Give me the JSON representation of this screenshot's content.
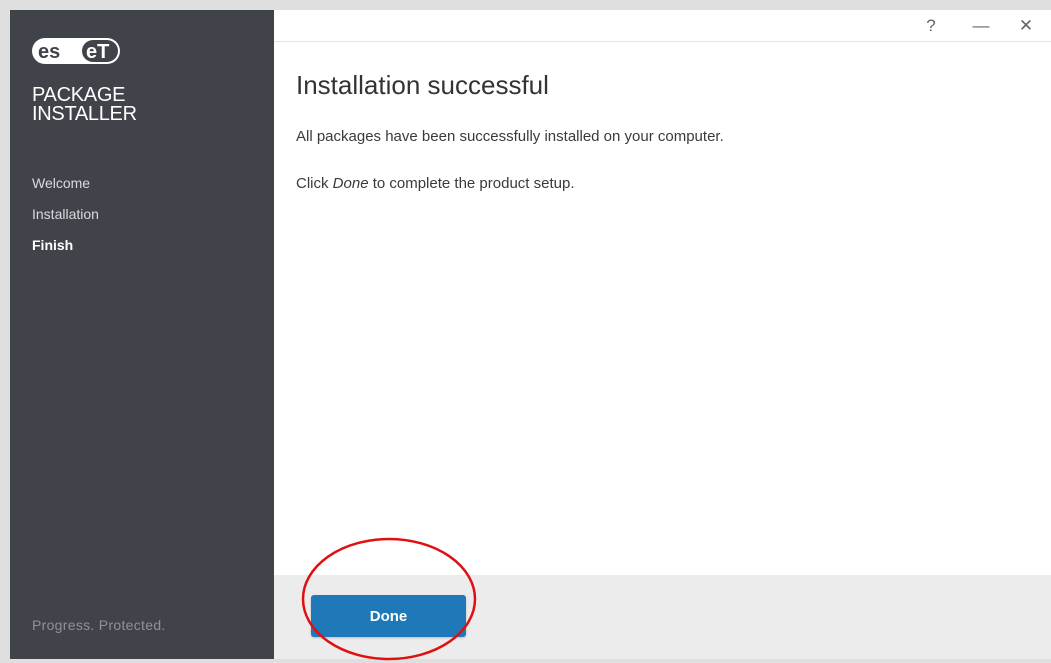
{
  "sidebar": {
    "brand": "eset",
    "product_line1": "Package",
    "product_line2": "Installer",
    "steps": [
      {
        "label": "Welcome",
        "active": false
      },
      {
        "label": "Installation",
        "active": false
      },
      {
        "label": "Finish",
        "active": true
      }
    ],
    "tagline": "Progress. Protected."
  },
  "titlebar": {
    "help_label": "?",
    "minimize_label": "—",
    "close_label": "✕"
  },
  "main": {
    "heading": "Installation successful",
    "message": "All packages have been successfully installed on your computer.",
    "instruction_prefix": "Click ",
    "instruction_emphasis": "Done",
    "instruction_suffix": " to complete the product setup."
  },
  "footer": {
    "done_label": "Done"
  },
  "colors": {
    "sidebar_bg": "#40434a",
    "accent": "#1f78b8",
    "annotation": "#e01010"
  }
}
